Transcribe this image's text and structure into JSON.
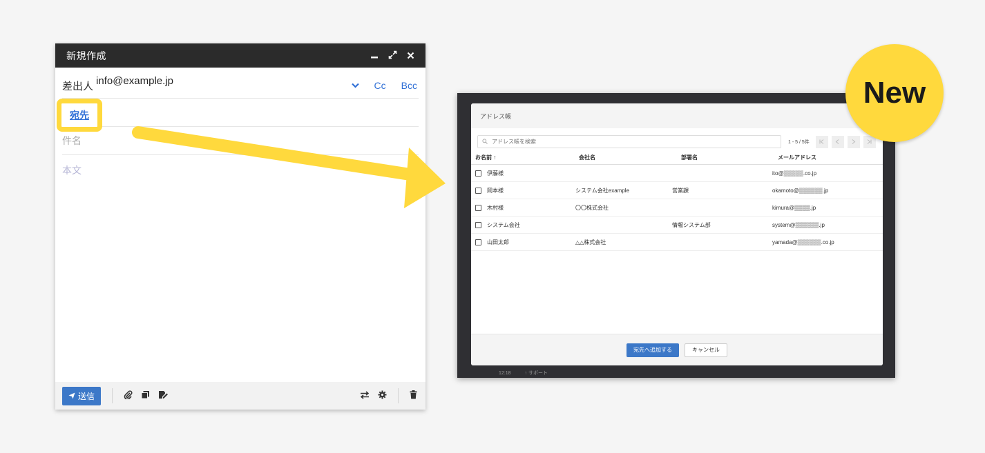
{
  "compose": {
    "title": "新規作成",
    "header_icons": [
      "minimize-icon",
      "expand-icon",
      "close-icon"
    ],
    "from_label": "差出人",
    "from_value": "info@example.jp",
    "cc_label": "Cc",
    "bcc_label": "Bcc",
    "to_label": "宛先",
    "subject_placeholder": "件名",
    "body_placeholder": "本文",
    "send_label": "送信"
  },
  "badge": {
    "label": "New",
    "color": "#ffd93d"
  },
  "address_book": {
    "title": "アドレス帳",
    "search_placeholder": "アドレス帳を検索",
    "pagination": "1 - 5 / 5件",
    "columns": [
      "お名前 ↑",
      "会社名",
      "部署名",
      "メールアドレス"
    ],
    "rows": [
      {
        "name": "伊藤様",
        "company": "",
        "dept": "",
        "email": "ito@▒▒▒▒▒.co.jp"
      },
      {
        "name": "岡本様",
        "company": "システム会社example",
        "dept": "営業課",
        "email": "okamoto@▒▒▒▒▒▒.jp"
      },
      {
        "name": "木村様",
        "company": "〇〇株式会社",
        "dept": "",
        "email": "kimura@▒▒▒▒.jp"
      },
      {
        "name": "システム会社",
        "company": "",
        "dept": "情報システム部",
        "email": "system@▒▒▒▒▒▒.jp"
      },
      {
        "name": "山田太郎",
        "company": "△△株式会社",
        "dept": "",
        "email": "yamada@▒▒▒▒▒▒.co.jp"
      }
    ],
    "add_label": "宛先へ追加する",
    "cancel_label": "キャンセル"
  },
  "background_strip": [
    "12:18",
    "↑ サポート"
  ],
  "colors": {
    "accent": "#3c78c8",
    "highlight": "#ffd93d",
    "link": "#2f6fd6"
  }
}
